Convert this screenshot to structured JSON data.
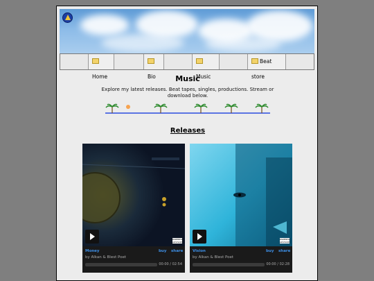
{
  "nav": {
    "items": [
      {
        "label": "Home",
        "icon": "folder-icon"
      },
      {
        "label": "Bio",
        "icon": "folder-icon"
      },
      {
        "label": "Music",
        "icon": "folder-icon"
      },
      {
        "label": "Beat store",
        "icon": "folder-icon"
      }
    ]
  },
  "page": {
    "title": "Music",
    "intro": "Explore my latest releases. Beat tapes, singles, productions. Stream or download below.",
    "releases_heading": "Releases"
  },
  "releases": [
    {
      "track": "Money",
      "buy": "buy",
      "share": "share",
      "byline": "by Alkan & Blest Poet",
      "time": "00:00 / 02:54"
    },
    {
      "track": "Vision",
      "buy": "buy",
      "share": "share",
      "byline": "by Alkan & Blest Poet",
      "time": "00:00 / 02:28"
    }
  ],
  "advisory": "PARENTAL ADVISORY",
  "colors": {
    "accent": "#3d8fe6",
    "player_bg": "#1a1a1a",
    "page_bg": "#ececec"
  }
}
